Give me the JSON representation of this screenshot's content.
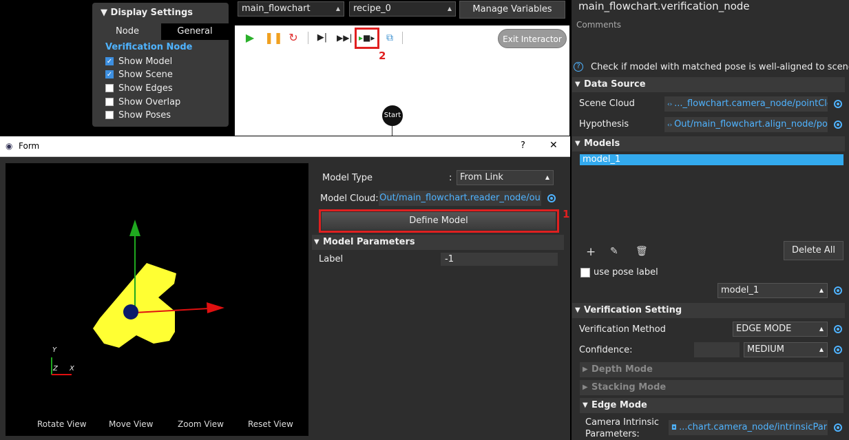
{
  "display_settings": {
    "title": "Display Settings",
    "tabs": [
      "Node",
      "General"
    ],
    "section": "Verification Node",
    "options": [
      {
        "label": "Show Model",
        "checked": true
      },
      {
        "label": "Show Scene",
        "checked": true
      },
      {
        "label": "Show Edges",
        "checked": false
      },
      {
        "label": "Show Overlap",
        "checked": false
      },
      {
        "label": "Show Poses",
        "checked": false
      }
    ]
  },
  "toolbar": {
    "flowchart_select": "main_flowchart",
    "recipe_select": "recipe_0",
    "manage_variables": "Manage Variables",
    "exit_interactor": "Exit Interactor",
    "annotation_2": "2",
    "start_node": "Start"
  },
  "form": {
    "title": "Form",
    "help": "?",
    "close": "✕",
    "viewer": {
      "axis_y": "Y",
      "axis_z": "Z",
      "axis_x": "X",
      "buttons": [
        "Rotate View",
        "Move View",
        "Zoom View",
        "Reset View"
      ]
    },
    "model_type_label": "Model Type",
    "model_type_colon": ":",
    "model_type_value": "From Link",
    "model_cloud_label": "Model Cloud:",
    "model_cloud_value": "Out/main_flowchart.reader_node/ou",
    "define_model": "Define Model",
    "annotation_1": "1",
    "model_parameters": "Model Parameters",
    "label_label": "Label",
    "label_value": "-1"
  },
  "right_panel": {
    "node_title": "main_flowchart.verification_node",
    "comments": "Comments",
    "description": "Check if model with matched pose is well-aligned to scene cloud",
    "data_source": "Data Source",
    "scene_cloud_label": "Scene Cloud",
    "scene_cloud_value": "..._flowchart.camera_node/pointCloud",
    "hypothesis_label": "Hypothesis",
    "hypothesis_value": "Out/main_flowchart.align_node/poses",
    "models": "Models",
    "model_items": [
      "model_1"
    ],
    "delete_all": "Delete All",
    "use_pose_label": "use pose label",
    "model_select": "model_1",
    "verification_setting": "Verification Setting",
    "verification_method_label": "Verification Method",
    "verification_method_value": "EDGE MODE",
    "confidence_label": "Confidence:",
    "confidence_value": "MEDIUM",
    "depth_mode": "Depth Mode",
    "stacking_mode": "Stacking Mode",
    "edge_mode": "Edge Mode",
    "camera_intrinsic_label_1": "Camera Intrinsic",
    "camera_intrinsic_label_2": "Parameters:",
    "camera_intrinsic_value": "...chart.camera_node/intrinsicParam"
  }
}
